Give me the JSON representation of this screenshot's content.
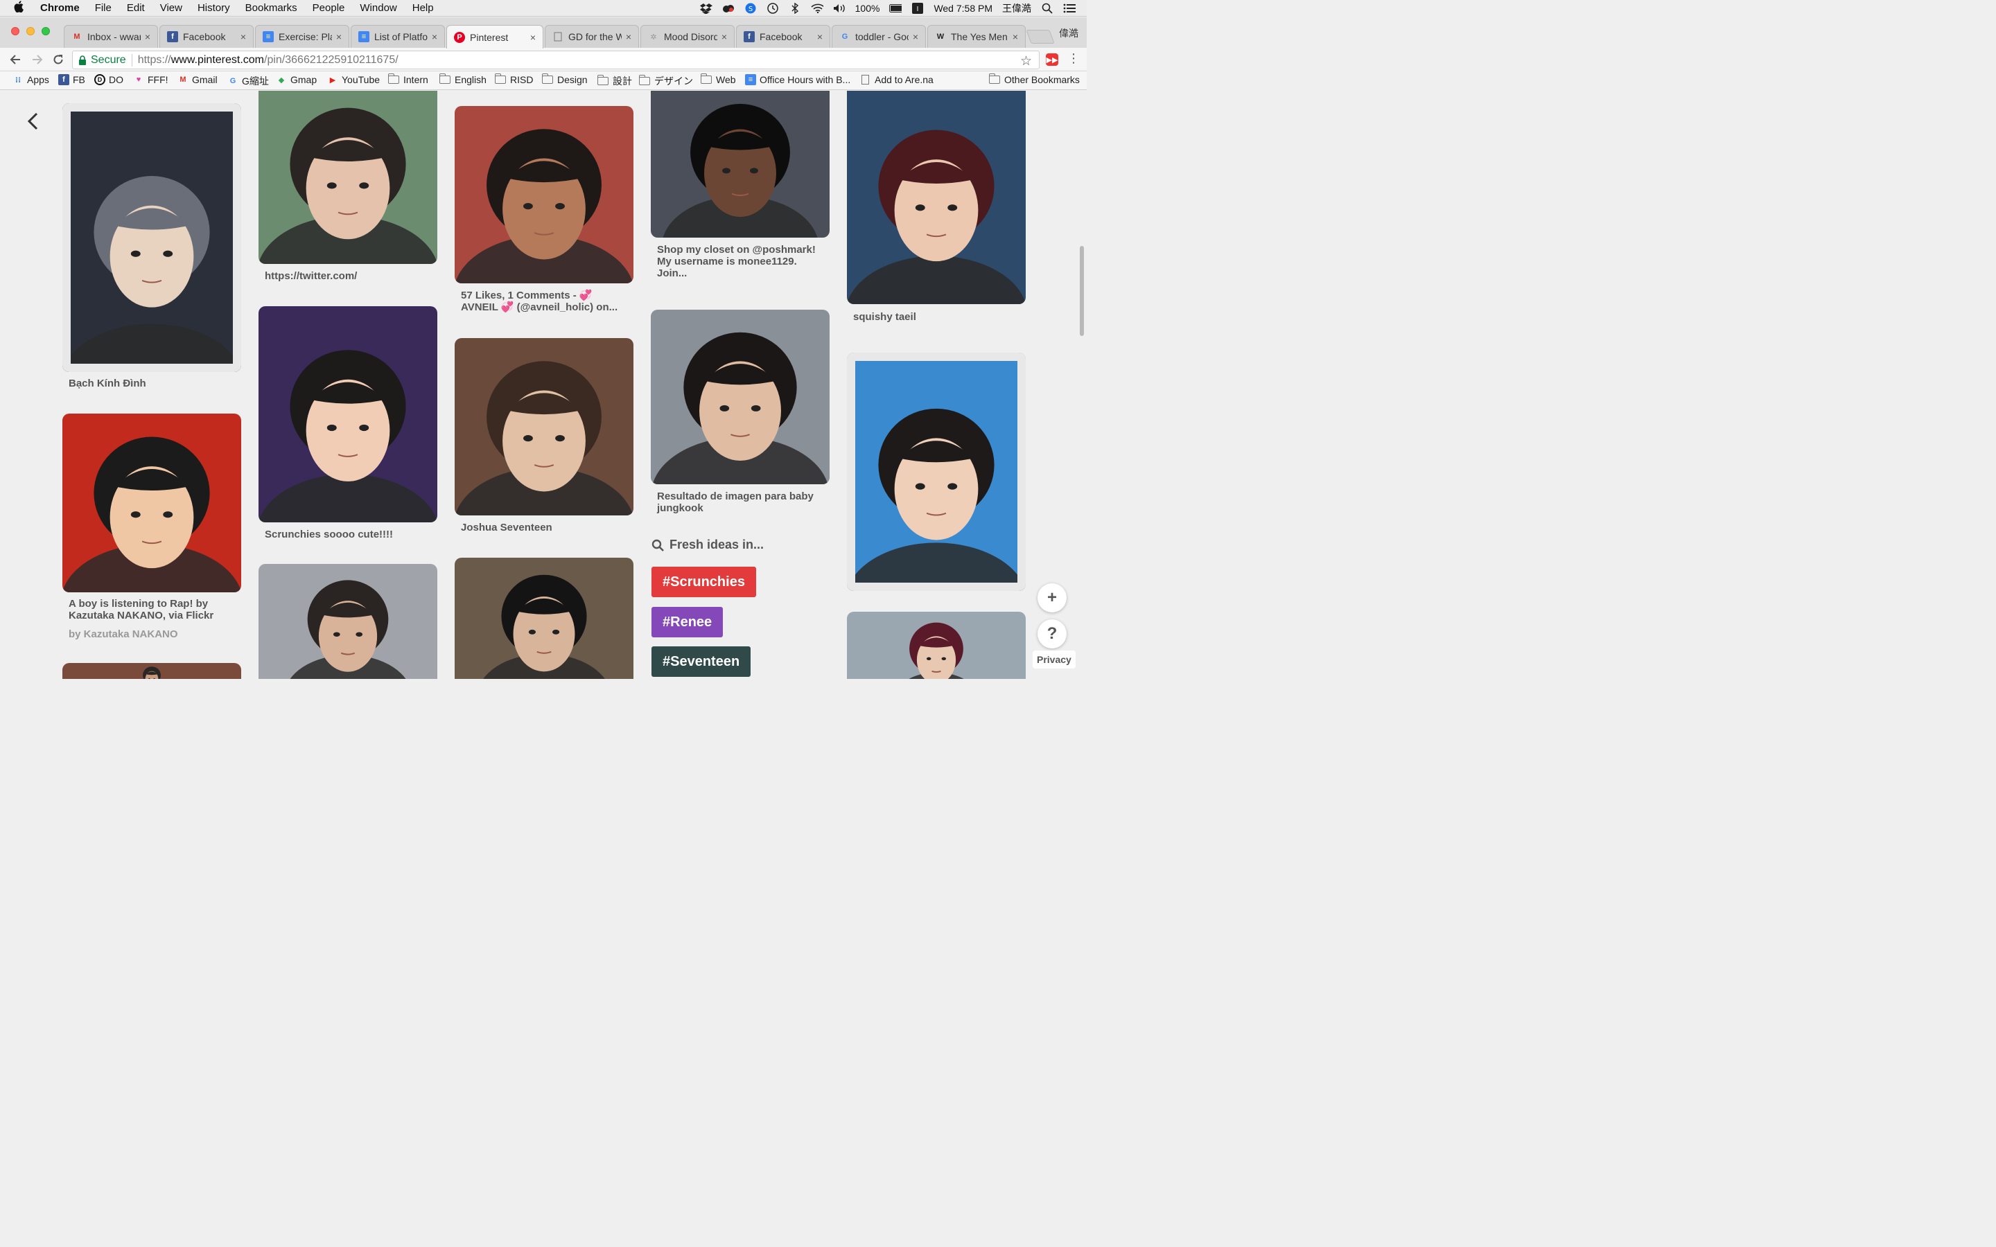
{
  "menubar": {
    "apple": "",
    "app": "Chrome",
    "items": [
      "File",
      "Edit",
      "View",
      "History",
      "Bookmarks",
      "People",
      "Window",
      "Help"
    ],
    "battery": "100%",
    "ime": "",
    "clock": "Wed 7:58 PM",
    "user": "王偉澔"
  },
  "tabs": [
    {
      "title": "Inbox - wwar",
      "icon": "gmail-icon",
      "fav": "M",
      "color": "#d93025"
    },
    {
      "title": "Facebook",
      "icon": "facebook-icon",
      "fav": "f",
      "color": "#3b5998"
    },
    {
      "title": "Exercise: Pla",
      "icon": "docs-icon",
      "fav": "≡",
      "color": "#4285f4"
    },
    {
      "title": "List of Platfo",
      "icon": "docs-icon",
      "fav": "≡",
      "color": "#4285f4"
    },
    {
      "title": "Pinterest",
      "icon": "pinterest-icon",
      "fav": "P",
      "color": "#e60023"
    },
    {
      "title": "GD for the W",
      "icon": "page-icon",
      "fav": "",
      "color": "#777"
    },
    {
      "title": "Mood Disord",
      "icon": "site-icon",
      "fav": "✲",
      "color": "#999"
    },
    {
      "title": "Facebook",
      "icon": "facebook-icon",
      "fav": "f",
      "color": "#3b5998"
    },
    {
      "title": "toddler - Goo",
      "icon": "google-icon",
      "fav": "G",
      "color": "#4285f4"
    },
    {
      "title": "The Yes Men",
      "icon": "wikipedia-icon",
      "fav": "W",
      "color": "#222"
    }
  ],
  "profile": "偉澔",
  "omnibox": {
    "secure_label": "Secure",
    "scheme": "https://",
    "host": "www.pinterest.com",
    "path": "/pin/366621225910211675/"
  },
  "bookmarks": [
    {
      "label": "Apps",
      "icon": "apps-grid-icon",
      "type": "icon",
      "glyph": "⁝⁝",
      "color": "#4285f4"
    },
    {
      "label": "FB",
      "icon": "facebook-icon",
      "type": "icon",
      "glyph": "f",
      "color": "#3b5998"
    },
    {
      "label": "DO",
      "icon": "digitalocean-icon",
      "type": "icon",
      "glyph": "D",
      "color": "#111"
    },
    {
      "label": "FFF!",
      "icon": "heart-icon",
      "type": "icon",
      "glyph": "♥",
      "color": "#e040a0"
    },
    {
      "label": "Gmail",
      "icon": "gmail-icon",
      "type": "icon",
      "glyph": "M",
      "color": "#d93025"
    },
    {
      "label": "G縮址",
      "icon": "google-icon",
      "type": "icon",
      "glyph": "G",
      "color": "#4285f4"
    },
    {
      "label": "Gmap",
      "icon": "maps-icon",
      "type": "icon",
      "glyph": "◆",
      "color": "#34a853"
    },
    {
      "label": "YouTube",
      "icon": "youtube-icon",
      "type": "icon",
      "glyph": "▶",
      "color": "#e62117"
    },
    {
      "label": "Intern",
      "icon": "folder-icon",
      "type": "folder"
    },
    {
      "label": "English",
      "icon": "folder-icon",
      "type": "folder"
    },
    {
      "label": "RISD",
      "icon": "folder-icon",
      "type": "folder"
    },
    {
      "label": "Design",
      "icon": "folder-icon",
      "type": "folder"
    },
    {
      "label": "設計",
      "icon": "folder-icon",
      "type": "folder"
    },
    {
      "label": "デザイン",
      "icon": "folder-icon",
      "type": "folder"
    },
    {
      "label": "Web",
      "icon": "folder-icon",
      "type": "folder"
    },
    {
      "label": "Office Hours with B...",
      "icon": "docs-icon",
      "type": "icon",
      "glyph": "≡",
      "color": "#4285f4"
    },
    {
      "label": "Add to Are.na",
      "icon": "page-icon",
      "type": "page"
    },
    {
      "label": "Other Bookmarks",
      "icon": "folder-icon",
      "type": "folder"
    }
  ],
  "pins": [
    {
      "caption": "Bạch Kính Đình",
      "sub": "",
      "colors": [
        "#2b2f3a",
        "#6a6e78",
        "#e8d2c0"
      ],
      "framed": true
    },
    {
      "caption": "A boy is listening to Rap! by Kazutaka NAKANO, via Flickr",
      "sub": "by Kazutaka NAKANO",
      "colors": [
        "#c12a1c",
        "#1b1b1b",
        "#f0c7a5"
      ],
      "framed": false
    },
    {
      "caption": "",
      "sub": "",
      "colors": [
        "#7a4a3a",
        "#2a2624",
        "#c99a7c"
      ],
      "framed": false
    },
    {
      "caption": "https://twitter.com/",
      "sub": "",
      "colors": [
        "#6c8c70",
        "#2a2522",
        "#e4c2ac"
      ],
      "framed": false
    },
    {
      "caption": "Scrunchies soooo cute!!!!",
      "sub": "",
      "colors": [
        "#3a2a5a",
        "#1d1a1a",
        "#f2cdb6"
      ],
      "framed": false
    },
    {
      "caption": "",
      "sub": "",
      "colors": [
        "#a0a4aa",
        "#2a2422",
        "#d9b29a"
      ],
      "framed": false
    },
    {
      "caption": "57 Likes, 1 Comments - 💞 AVNEIL 💞 (@avneil_holic) on...",
      "sub": "",
      "colors": [
        "#a8483f",
        "#1e1816",
        "#b47a5a"
      ],
      "framed": false
    },
    {
      "caption": "Joshua Seventeen",
      "sub": "",
      "colors": [
        "#6a4a3a",
        "#3a2a22",
        "#e2c0a6"
      ],
      "framed": false
    },
    {
      "caption": "",
      "sub": "",
      "colors": [
        "#6a5a4a",
        "#151414",
        "#d8b49a"
      ],
      "framed": false
    },
    {
      "caption": "Shop my closet on @poshmark! My username is monee1129. Join...",
      "sub": "",
      "colors": [
        "#4a4f5a",
        "#0e0d0d",
        "#6b4634"
      ],
      "framed": false
    },
    {
      "caption": "Resultado de imagen para baby jungkook",
      "sub": "",
      "colors": [
        "#8a9098",
        "#1b1716",
        "#e0bca2"
      ],
      "framed": false
    },
    {
      "caption": "squishy taeil",
      "sub": "",
      "colors": [
        "#2e4a6a",
        "#4a1a1e",
        "#ecc8b0"
      ],
      "framed": false
    },
    {
      "caption": "",
      "sub": "",
      "colors": [
        "#3a8ad0",
        "#1e1a1a",
        "#efcfb8"
      ],
      "framed": true
    },
    {
      "caption": "",
      "sub": "",
      "colors": [
        "#9aa6b0",
        "#5a1a2a",
        "#e8c8b0"
      ],
      "framed": false
    }
  ],
  "fresh_ideas": {
    "label": "Fresh ideas in...",
    "tags": [
      {
        "label": "#Scrunchies",
        "color": "#e33b3b"
      },
      {
        "label": "#Renee",
        "color": "#8548b8"
      },
      {
        "label": "#Seventeen",
        "color": "#2f4a48"
      }
    ]
  },
  "fab": {
    "add": "+",
    "help": "?",
    "privacy": "Privacy"
  }
}
